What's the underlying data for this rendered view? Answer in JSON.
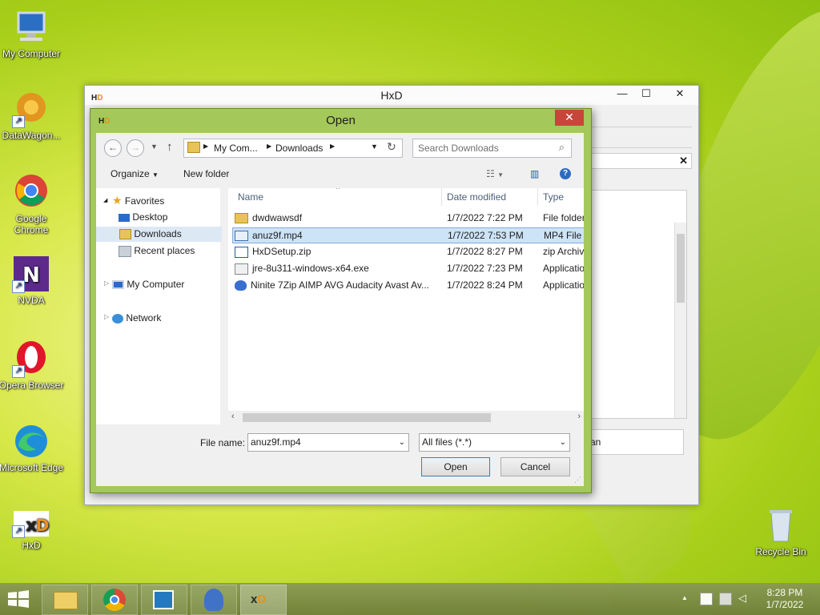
{
  "desktop": {
    "icons": [
      {
        "label": "My Computer"
      },
      {
        "label": "DataWagon..."
      },
      {
        "label": "Google Chrome"
      },
      {
        "label": "NVDA"
      },
      {
        "label": "Opera Browser"
      },
      {
        "label": "Microsoft Edge"
      },
      {
        "label": "HxD"
      },
      {
        "label": "Recycle Bin"
      }
    ]
  },
  "hxd": {
    "title": "HxD",
    "min": "—",
    "max": "☐",
    "close": "✕",
    "inner_close": "✕",
    "partial_text": "an"
  },
  "dialog": {
    "title": "Open",
    "close": "✕",
    "address": {
      "segments": [
        "My Com...",
        "Downloads"
      ]
    },
    "search_placeholder": "Search Downloads",
    "toolbar": {
      "organize": "Organize",
      "new_folder": "New folder"
    },
    "nav": {
      "favorites": "Favorites",
      "desktop": "Desktop",
      "downloads": "Downloads",
      "recent": "Recent places",
      "my_computer": "My Computer",
      "network": "Network"
    },
    "columns": {
      "name": "Name",
      "date": "Date modified",
      "type": "Type"
    },
    "files": [
      {
        "name": "dwdwawsdf",
        "date": "1/7/2022 7:22 PM",
        "type": "File folder",
        "icon": "folder-icon"
      },
      {
        "name": "anuz9f.mp4",
        "date": "1/7/2022 7:53 PM",
        "type": "MP4 File",
        "icon": "video-file-icon"
      },
      {
        "name": "HxDSetup.zip",
        "date": "1/7/2022 8:27 PM",
        "type": "zip Archive",
        "icon": "zip-file-icon"
      },
      {
        "name": "jre-8u311-windows-x64.exe",
        "date": "1/7/2022 7:23 PM",
        "type": "Application",
        "icon": "exe-file-icon"
      },
      {
        "name": "Ninite 7Zip AIMP AVG Audacity Avast Av...",
        "date": "1/7/2022 8:24 PM",
        "type": "Application",
        "icon": "ninite-icon"
      }
    ],
    "filename_label": "File name:",
    "filename_value": "anuz9f.mp4",
    "filetype_value": "All files (*.*)",
    "open_button": "Open",
    "cancel_button": "Cancel"
  },
  "taskbar": {
    "time": "8:28 PM",
    "date": "1/7/2022",
    "tray_up": "▲"
  }
}
